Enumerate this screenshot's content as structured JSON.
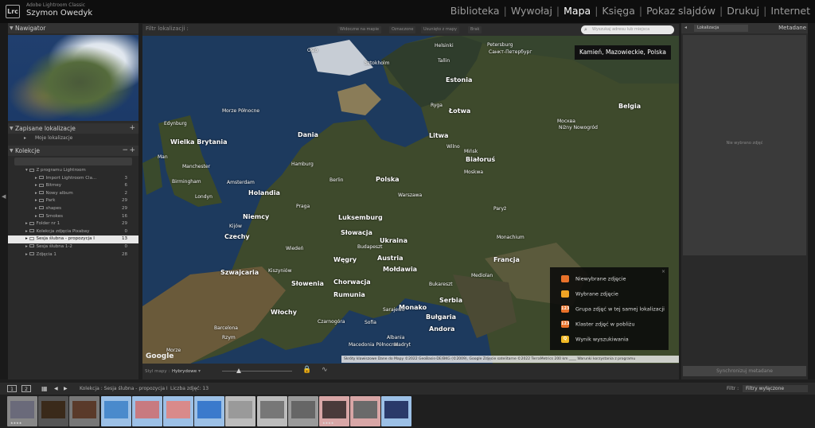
{
  "app": {
    "name": "Adobe Lightroom Classic",
    "user": "Szymon Owedyk",
    "logo": "Lrc"
  },
  "modules": [
    {
      "label": "Biblioteka",
      "active": false
    },
    {
      "label": "Wywołaj",
      "active": false
    },
    {
      "label": "Mapa",
      "active": true
    },
    {
      "label": "Księga",
      "active": false
    },
    {
      "label": "Pokaz slajdów",
      "active": false
    },
    {
      "label": "Drukuj",
      "active": false
    },
    {
      "label": "Internet",
      "active": false
    }
  ],
  "left": {
    "navigator": "Nawigator",
    "saved_locations": "Zapisane lokalizacje",
    "my_locations": "Moje lokalizacje",
    "collections": "Kolekcje",
    "tree": [
      {
        "label": "Z programu Lightroom",
        "count": "",
        "indent": 1
      },
      {
        "label": "Import Lightroom Cla...",
        "count": "3",
        "indent": 2
      },
      {
        "label": "Bitmey",
        "count": "6",
        "indent": 2
      },
      {
        "label": "Nowy album",
        "count": "2",
        "indent": 2
      },
      {
        "label": "Park",
        "count": "29",
        "indent": 2
      },
      {
        "label": "shapes",
        "count": "29",
        "indent": 2
      },
      {
        "label": "Smokes",
        "count": "16",
        "indent": 2
      },
      {
        "label": "Folder nr 1",
        "count": "29",
        "indent": 1
      },
      {
        "label": "Kolekcja zdjęcia Pixabay",
        "count": "0",
        "indent": 1
      },
      {
        "label": "Sesja ślubna - propozycja I",
        "count": "13",
        "indent": 1,
        "selected": true
      },
      {
        "label": "Sesja ślubna 1-2",
        "count": "0",
        "indent": 1
      },
      {
        "label": "Zdjęcia 1",
        "count": "28",
        "indent": 1
      }
    ]
  },
  "map": {
    "filter_label": "Filtr lokalizacji :",
    "filter_buttons": [
      "Widoczne na mapie",
      "Oznaczone",
      "Usunięto z mapy",
      "Brak"
    ],
    "search_placeholder": "Wyszukaj adresu lub miejsca",
    "location": "Kamień, Mazowieckie, Polska",
    "labels": [
      {
        "t": "Oslo",
        "c": "sm"
      },
      {
        "t": "Helsinki",
        "c": "sm"
      },
      {
        "t": "Petersburg",
        "c": "sm"
      },
      {
        "t": "Санкт-Петербург",
        "c": "sm"
      },
      {
        "t": "Sztokholm",
        "c": "sm"
      },
      {
        "t": "Tallin",
        "c": "sm"
      },
      {
        "t": "Estonia",
        "c": "big"
      },
      {
        "t": "Ryga",
        "c": "sm"
      },
      {
        "t": "Łotwa",
        "c": "big"
      },
      {
        "t": "Morze Północne",
        "c": "sm"
      },
      {
        "t": "Dania",
        "c": "big"
      },
      {
        "t": "Edynburg",
        "c": "sm"
      },
      {
        "t": "Wielka Brytania",
        "c": "big"
      },
      {
        "t": "Man",
        "c": "sm"
      },
      {
        "t": "Manchester",
        "c": "sm"
      },
      {
        "t": "Birmingham",
        "c": "sm"
      },
      {
        "t": "Londyn",
        "c": "sm"
      },
      {
        "t": "Hamburg",
        "c": "sm"
      },
      {
        "t": "Amsterdam",
        "c": "sm"
      },
      {
        "t": "Holandia",
        "c": "big"
      },
      {
        "t": "Berlin",
        "c": "sm"
      },
      {
        "t": "Polska",
        "c": "big"
      },
      {
        "t": "Warszawa",
        "c": "sm"
      },
      {
        "t": "Litwa",
        "c": "big"
      },
      {
        "t": "Wilno",
        "c": "sm"
      },
      {
        "t": "Mińsk",
        "c": "sm"
      },
      {
        "t": "Białoruś",
        "c": "big"
      },
      {
        "t": "Moskwa",
        "c": "sm"
      },
      {
        "t": "Москва",
        "c": "sm"
      },
      {
        "t": "Niżny Nowogród",
        "c": "sm"
      },
      {
        "t": "Belgia",
        "c": "big"
      },
      {
        "t": "Niemcy",
        "c": "big"
      },
      {
        "t": "Praga",
        "c": "sm"
      },
      {
        "t": "Luksemburg",
        "c": "big"
      },
      {
        "t": "Kijów",
        "c": "sm"
      },
      {
        "t": "Paryż",
        "c": "sm"
      },
      {
        "t": "Czechy",
        "c": "big"
      },
      {
        "t": "Słowacja",
        "c": "big"
      },
      {
        "t": "Ukraina",
        "c": "big"
      },
      {
        "t": "Monachium",
        "c": "sm"
      },
      {
        "t": "Wiedeń",
        "c": "sm"
      },
      {
        "t": "Budapeszt",
        "c": "sm"
      },
      {
        "t": "Austria",
        "c": "big"
      },
      {
        "t": "Węgry",
        "c": "big"
      },
      {
        "t": "Mołdawia",
        "c": "big"
      },
      {
        "t": "Francja",
        "c": "big"
      },
      {
        "t": "Szwajcaria",
        "c": "big"
      },
      {
        "t": "Kiszyniów",
        "c": "sm"
      },
      {
        "t": "Mediolan",
        "c": "sm"
      },
      {
        "t": "Słowenia",
        "c": "big"
      },
      {
        "t": "Chorwacja",
        "c": "big"
      },
      {
        "t": "Rumunia",
        "c": "big"
      },
      {
        "t": "Bukareszt",
        "c": "sm"
      },
      {
        "t": "Serbia",
        "c": "big"
      },
      {
        "t": "Sarajewo",
        "c": "sm"
      },
      {
        "t": "Monako",
        "c": "big"
      },
      {
        "t": "Włochy",
        "c": "big"
      },
      {
        "t": "Czarnogóra",
        "c": "sm"
      },
      {
        "t": "Sofia",
        "c": "sm"
      },
      {
        "t": "Bułgaria",
        "c": "big"
      },
      {
        "t": "Andora",
        "c": "big"
      },
      {
        "t": "Barcelona",
        "c": "sm"
      },
      {
        "t": "Rzym",
        "c": "sm"
      },
      {
        "t": "Macedonia Północna",
        "c": "sm"
      },
      {
        "t": "Albania",
        "c": "sm"
      },
      {
        "t": "Madryt",
        "c": "sm"
      },
      {
        "t": "Morze",
        "c": "sm"
      }
    ],
    "legend": [
      {
        "label": "Niewybrane zdjęcie",
        "color": "#e8722a",
        "text": ""
      },
      {
        "label": "Wybrane zdjęcie",
        "color": "#f0a424",
        "text": ""
      },
      {
        "label": "Grupa zdjęć w tej samej lokalizacji",
        "color": "#e8722a",
        "text": "123"
      },
      {
        "label": "Klaster zdjęć w pobliżu",
        "color": "#e8722a",
        "text": "123"
      },
      {
        "label": "Wynik wyszukiwania",
        "color": "#f0b824",
        "text": "Q"
      }
    ],
    "google": "Google",
    "attribution": "Skróty klawiszowe   Dane do Mapy ©2022 GeoBasis-DE/BKG (©2009), Google Zdjęcie satelitarne ©2022 TerraMetrics   200 km ____   Warunki korzystania z programu",
    "style_label": "Styl mapy :",
    "style_value": "Hybrydowe"
  },
  "right": {
    "select": "Lokalizacja",
    "title": "Metadane",
    "empty": "Nie wybrano zdjęć",
    "sync": "Synchronizuj metadane"
  },
  "filmstrip": {
    "page1": "1",
    "page2": "2",
    "breadcrumb": "Kolekcja : Sesja ślubna - propozycja I",
    "count": "Liczba zdjęć: 13",
    "filter_label": "Filtr :",
    "filter_value": "Filtry wyłączone",
    "thumbs": [
      {
        "bg": "#888",
        "img": "#6a6a7a",
        "stars": "★★★★"
      },
      {
        "bg": "#555",
        "img": "#3a2a1a",
        "stars": ""
      },
      {
        "bg": "#777",
        "img": "#5a3a2a",
        "stars": ""
      },
      {
        "bg": "#9cc0e6",
        "img": "#4a8acc",
        "stars": ""
      },
      {
        "bg": "#9cc0e6",
        "img": "#c87a80",
        "stars": ""
      },
      {
        "bg": "#9cc0e6",
        "img": "#d98a8a",
        "stars": ""
      },
      {
        "bg": "#9cc0e6",
        "img": "#3a7acc",
        "stars": ""
      },
      {
        "bg": "#bcbcbc",
        "img": "#9a9a9a",
        "stars": ""
      },
      {
        "bg": "#bcbcbc",
        "img": "#777",
        "stars": ""
      },
      {
        "bg": "#9a9a9a",
        "img": "#666",
        "stars": ""
      },
      {
        "bg": "#d8a6a6",
        "img": "#4a3a3a",
        "stars": "★★★★"
      },
      {
        "bg": "#d8a6a6",
        "img": "#6a6a6a",
        "stars": ""
      },
      {
        "bg": "#9cc0e6",
        "img": "#2a3a6a",
        "stars": ""
      }
    ]
  }
}
